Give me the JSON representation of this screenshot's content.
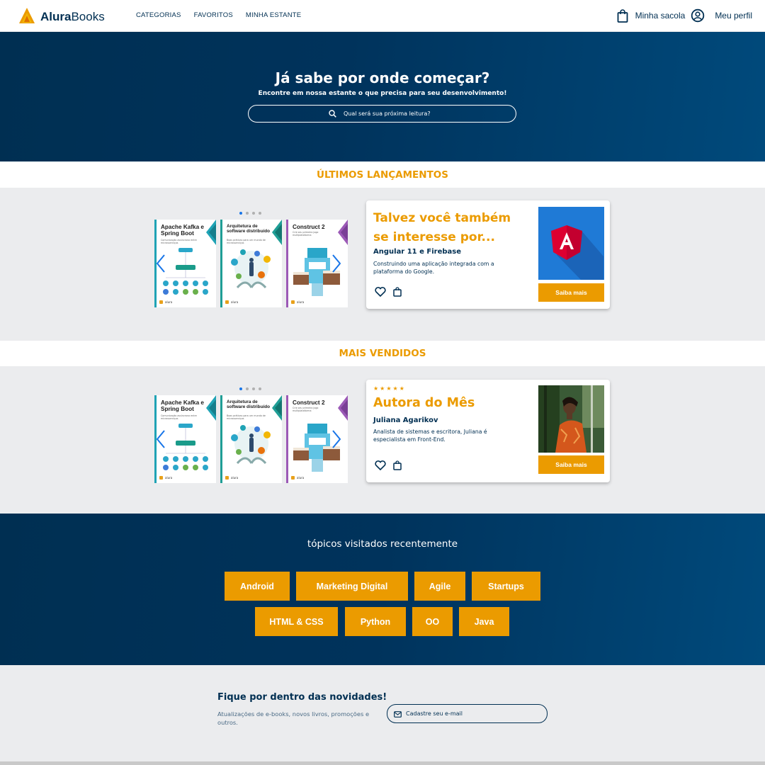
{
  "header": {
    "logo_brand": "Alura",
    "logo_suffix": "Books",
    "nav": [
      "CATEGORIAS",
      "FAVORITOS",
      "MINHA ESTANTE"
    ],
    "bag_label": "Minha sacola",
    "profile_label": "Meu perfil"
  },
  "hero": {
    "title": "Já sabe por onde começar?",
    "subtitle": "Encontre em nossa estante o que precisa para seu desenvolvimento!",
    "search_placeholder": "Qual será sua próxima leitura?"
  },
  "launches": {
    "title": "ÚLTIMOS LANÇAMENTOS",
    "card": {
      "heading_line1": "Talvez você também",
      "heading_line2": "se interesse por...",
      "book_title": "Angular 11 e Firebase",
      "description": "Construindo uma aplicação integrada com a plataforma do Google.",
      "button": "Saiba mais"
    }
  },
  "bestsellers": {
    "title": "MAIS VENDIDOS",
    "card": {
      "stars": "★★★★★",
      "heading": "Autora do Mês",
      "author": "Juliana Agarikov",
      "description": "Analista de sistemas e escritora, Juliana é especialista em Front-End.",
      "button": "Saiba mais"
    }
  },
  "books": [
    {
      "title": "Apache Kafka e Spring Boot",
      "subtitle": "Comunicação assíncrona entre microsserviços",
      "accent": "#1fa3b5"
    },
    {
      "title": "Arquitetura de software distribuído",
      "subtitle": "Boas práticas para um mundo de microsserviços",
      "accent": "#1f9e96"
    },
    {
      "title": "Construct 2",
      "subtitle": "Crie seu primeiro jogo multiplataforma",
      "accent": "#9b59b6"
    }
  ],
  "book_footer": "alura",
  "topics": {
    "title": "tópicos visitados recentemente",
    "row1": [
      "Android",
      "Marketing Digital",
      "Agile",
      "Startups"
    ],
    "row2": [
      "HTML & CSS",
      "Python",
      "OO",
      "Java"
    ]
  },
  "newsletter": {
    "title": "Fique por dentro das novidades!",
    "text": "Atualizações de e-books, novos livros, promoções e outros.",
    "email_placeholder": "Cadastre seu e-mail"
  },
  "colors": {
    "navy": "#002f52",
    "orange": "#eb9b00",
    "gray_band": "#ebecee",
    "angular_blue": "#1f7ad6",
    "angular_red": "#dd0031"
  }
}
